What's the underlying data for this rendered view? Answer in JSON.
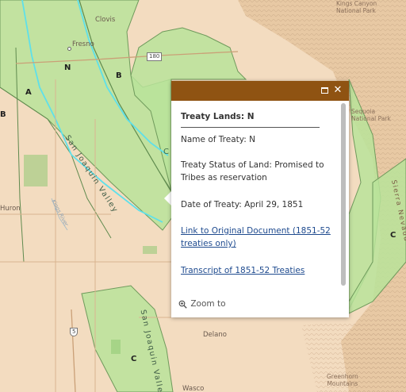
{
  "map": {
    "places": {
      "clovis": "Clovis",
      "fresno": "Fresno",
      "kings_canyon": "Kings Canyon\nNational Park",
      "sequoia": "Sequoia\nNational Park",
      "huron": "Huron",
      "delano": "Delano",
      "wasco": "Wasco",
      "greenhorn": "Greenhorn\nMountains"
    },
    "zones": {
      "a": "A",
      "b_left": "B",
      "n": "N",
      "b_right": "B",
      "c_east": "C",
      "c_south": "C",
      "c_partial": "C"
    },
    "features": {
      "valley_north": "San Joaquin Valley",
      "valley_south": "San Joaquin Valley",
      "sierra": "Sierra Nevada",
      "kings_river": "Kings River"
    },
    "highways": {
      "hwy_180": "180",
      "hwy_5": "5"
    },
    "colors": {
      "base": "#f3dcc0",
      "treaty_fill": "#b9e39a",
      "treaty_stroke": "#6f9a5c",
      "river": "#5ee0ea",
      "popup_header": "#8f5312",
      "link": "#1f4b8f"
    }
  },
  "popup": {
    "maximize_icon": "maximize-icon",
    "close_icon": "close-icon",
    "close_glyph": "✕",
    "title": "Treaty Lands: N",
    "name_line": "Name of Treaty: N",
    "status_line": "Treaty Status of Land: Promised to Tribes as reservation",
    "date_line": "Date of Treaty: April 29, 1851",
    "link_original": "Link to Original Document (1851-52 treaties only)",
    "link_transcript": "Transcript of 1851-52 Treaties",
    "zoom_label": "Zoom to",
    "zoom_icon": "zoom-in-icon"
  }
}
